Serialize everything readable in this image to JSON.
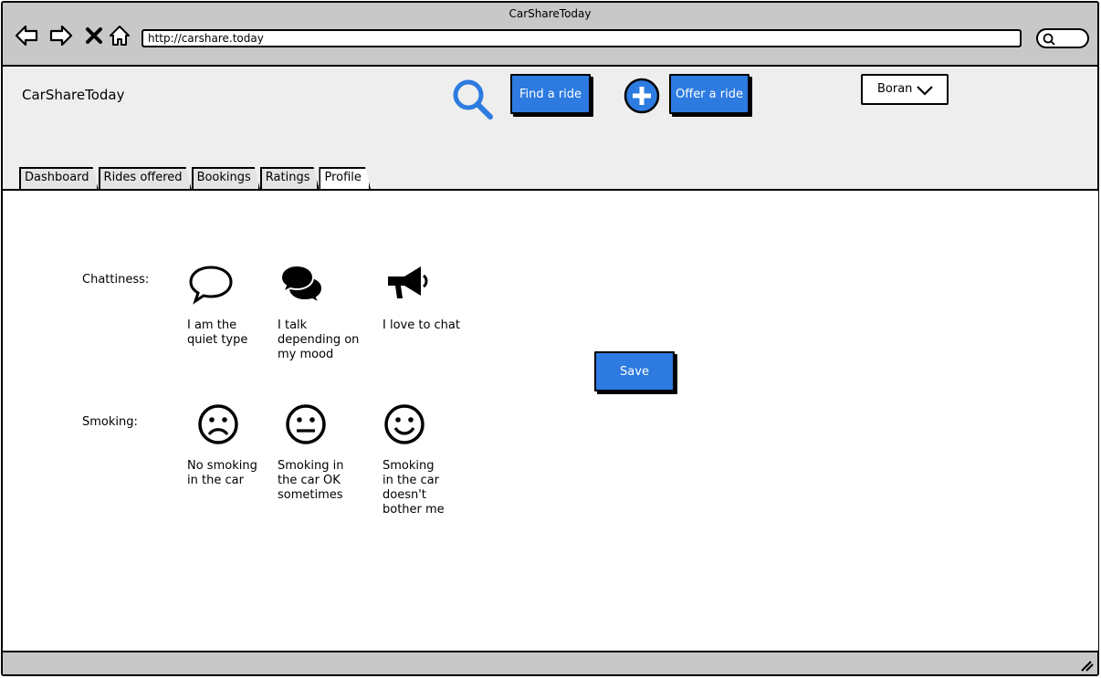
{
  "browser": {
    "window_title": "CarShareToday",
    "url": "http://carshare.today"
  },
  "header": {
    "brand": "CarShareToday",
    "find_ride_label": "Find a ride",
    "offer_ride_label": "Offer a ride",
    "user_name": "Boran"
  },
  "tabs": [
    {
      "label": "Dashboard"
    },
    {
      "label": "Rides offered"
    },
    {
      "label": "Bookings"
    },
    {
      "label": "Ratings"
    },
    {
      "label": "Profile"
    }
  ],
  "preferences": {
    "chattiness": {
      "label": "Chattiness:",
      "options": [
        {
          "icon": "speech-bubble-icon",
          "caption": "I am the quiet type"
        },
        {
          "icon": "chat-bubbles-icon",
          "caption": "I talk depending on my mood"
        },
        {
          "icon": "megaphone-icon",
          "caption": "I love to chat"
        }
      ]
    },
    "smoking": {
      "label": "Smoking:",
      "options": [
        {
          "icon": "sad-face-icon",
          "caption": "No smoking in the car"
        },
        {
          "icon": "neutral-face-icon",
          "caption": "Smoking in the car OK sometimes"
        },
        {
          "icon": "happy-face-icon",
          "caption": "Smoking in the car doesn't bother me"
        }
      ]
    }
  },
  "save_label": "Save",
  "colors": {
    "accent": "#2d7be0",
    "chrome": "#c8c8c8",
    "header_bg": "#eeeeee"
  }
}
